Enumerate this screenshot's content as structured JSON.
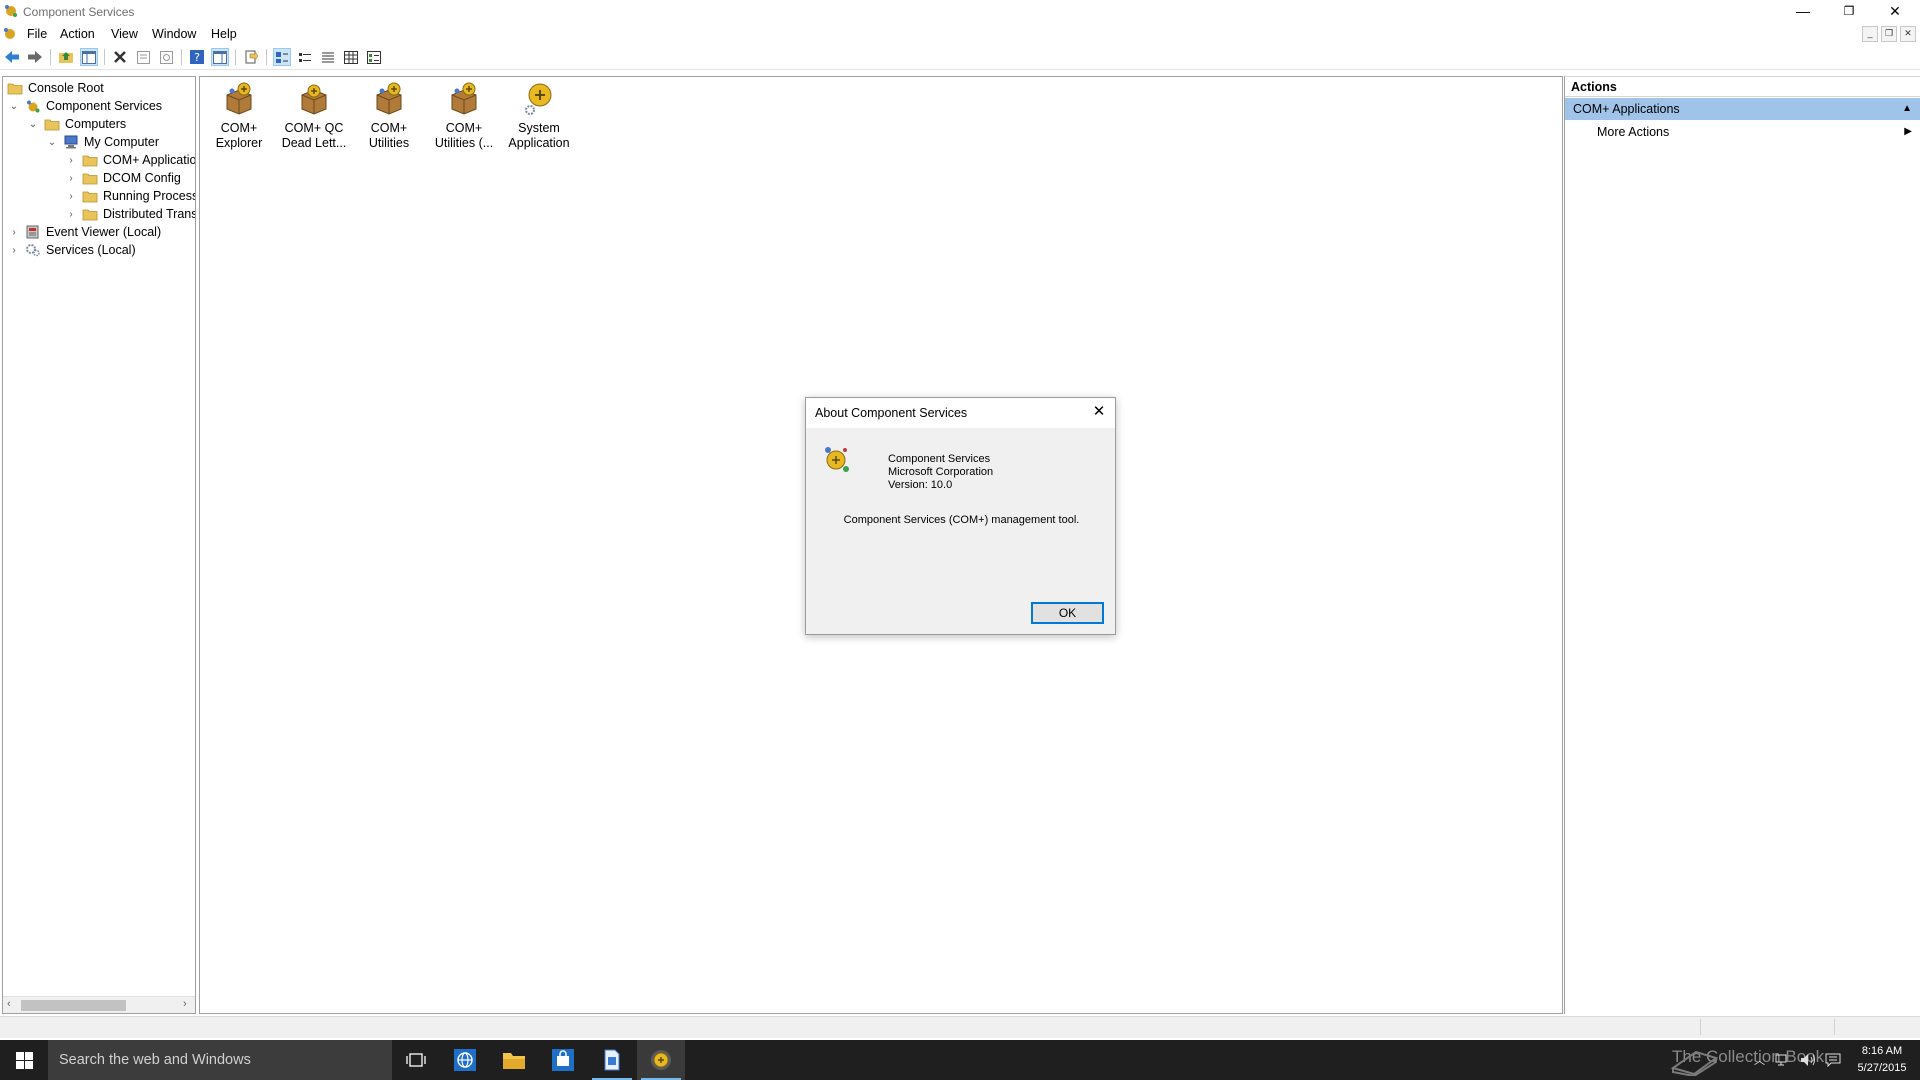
{
  "window": {
    "title": "Component Services",
    "controls": {
      "minimize": "—",
      "restore": "❐",
      "close": "✕"
    }
  },
  "menubar": {
    "items": [
      "File",
      "Action",
      "View",
      "Window",
      "Help"
    ],
    "mdi_controls": {
      "minimize": "_",
      "restore": "❐",
      "close": "✕"
    }
  },
  "tree": {
    "items": [
      {
        "label": "Console Root",
        "expander": "",
        "icon": "folder-icon"
      },
      {
        "label": "Component Services",
        "expander": "expanded",
        "icon": "component-services-icon"
      },
      {
        "label": "Computers",
        "expander": "expanded",
        "icon": "folder-icon"
      },
      {
        "label": "My Computer",
        "expander": "expanded",
        "icon": "computer-icon"
      },
      {
        "label": "COM+ Applicatio",
        "expander": "collapsed",
        "icon": "folder-icon"
      },
      {
        "label": "DCOM Config",
        "expander": "collapsed",
        "icon": "folder-icon"
      },
      {
        "label": "Running Processe",
        "expander": "collapsed",
        "icon": "folder-icon"
      },
      {
        "label": "Distributed Transa",
        "expander": "collapsed",
        "icon": "folder-icon"
      },
      {
        "label": "Event Viewer (Local)",
        "expander": "collapsed",
        "icon": "event-viewer-icon"
      },
      {
        "label": "Services (Local)",
        "expander": "collapsed",
        "icon": "services-icon"
      }
    ]
  },
  "list": {
    "items": [
      {
        "line1": "COM+",
        "line2": "Explorer",
        "icon": "com-package-icon"
      },
      {
        "line1": "COM+ QC",
        "line2": "Dead Lett...",
        "icon": "com-package-icon"
      },
      {
        "line1": "COM+",
        "line2": "Utilities",
        "icon": "com-package-icon"
      },
      {
        "line1": "COM+",
        "line2": "Utilities (...",
        "icon": "com-package-icon"
      },
      {
        "line1": "System",
        "line2": "Application",
        "icon": "system-application-icon"
      }
    ]
  },
  "actions": {
    "header": "Actions",
    "section": "COM+ Applications",
    "item": "More Actions",
    "section_color": "#9fc3e9"
  },
  "dialog": {
    "title": "About Component Services",
    "close": "✕",
    "product": "Component Services",
    "company": "Microsoft Corporation",
    "version": "Version: 10.0",
    "description": "Component Services (COM+) management tool.",
    "ok": "OK"
  },
  "taskbar": {
    "search_placeholder": "Search the web and Windows",
    "watermark": "The Collection Book",
    "time": "8:16 AM",
    "date": "5/27/2015",
    "accent": "#76b9ed"
  }
}
